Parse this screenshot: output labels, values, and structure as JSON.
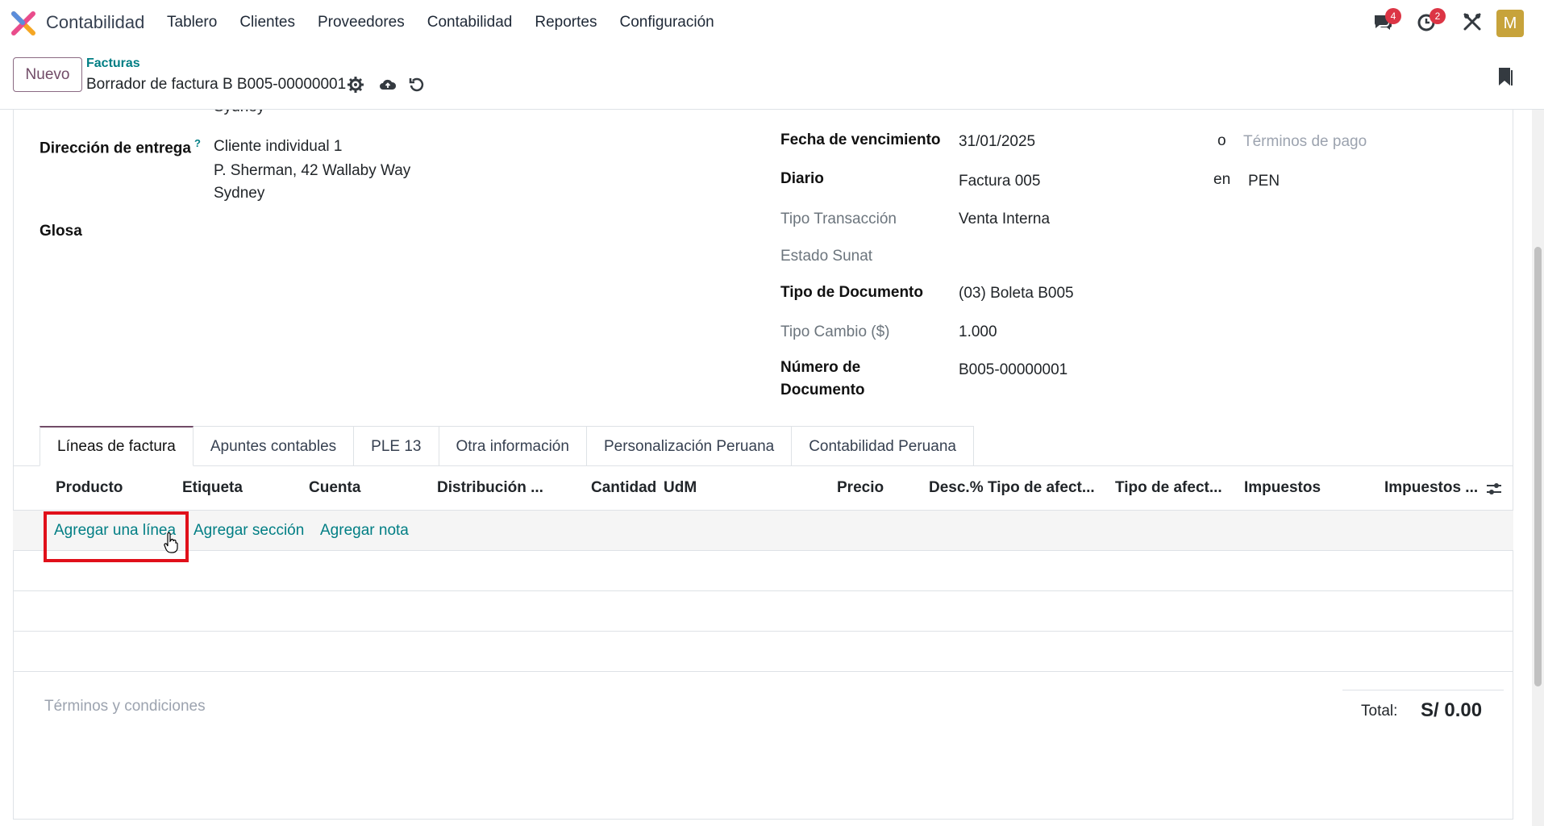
{
  "app": {
    "name": "Contabilidad",
    "user_initial": "M"
  },
  "menu": [
    "Tablero",
    "Clientes",
    "Proveedores",
    "Contabilidad",
    "Reportes",
    "Configuración"
  ],
  "badges": {
    "messages": "4",
    "activities": "2"
  },
  "control": {
    "new_button": "Nuevo",
    "breadcrumb_parent": "Facturas",
    "breadcrumb_current": "Borrador de factura B B005-00000001"
  },
  "form": {
    "partial_top": "Sydney",
    "delivery_label": "Dirección de entrega",
    "delivery_help": "?",
    "delivery_lines": [
      "Cliente individual 1",
      "P. Sherman, 42 Wallaby Way",
      "Sydney"
    ],
    "glosa_label": "Glosa",
    "due_date_label": "Fecha de vencimiento",
    "due_date": "31/01/2025",
    "or_text": "o",
    "payment_terms_placeholder": "Términos de pago",
    "journal_label": "Diario",
    "journal": "Factura 005",
    "in_text": "en",
    "currency": "PEN",
    "transaction_type_label": "Tipo Transacción",
    "transaction_type": "Venta Interna",
    "sunat_state_label": "Estado Sunat",
    "doc_type_label": "Tipo de Documento",
    "doc_type": "(03) Boleta B005",
    "exchange_label": "Tipo Cambio ($)",
    "exchange": "1.000",
    "doc_number_label_1": "Número de",
    "doc_number_label_2": "Documento",
    "doc_number": "B005-00000001"
  },
  "tabs": [
    "Líneas de factura",
    "Apuntes contables",
    "PLE 13",
    "Otra información",
    "Personalización Peruana",
    "Contabilidad Peruana"
  ],
  "table": {
    "columns": [
      "Producto",
      "Etiqueta",
      "Cuenta",
      "Distribución ...",
      "Cantidad",
      "UdM",
      "Precio",
      "Desc.%",
      "Tipo de afect...",
      "Tipo de afect...",
      "Impuestos",
      "Impuestos ..."
    ],
    "add_line": "Agregar una línea",
    "add_section": "Agregar sección",
    "add_note": "Agregar nota"
  },
  "footer": {
    "terms_placeholder": "Términos y condiciones",
    "total_label": "Total:",
    "total_value": "S/ 0.00"
  }
}
